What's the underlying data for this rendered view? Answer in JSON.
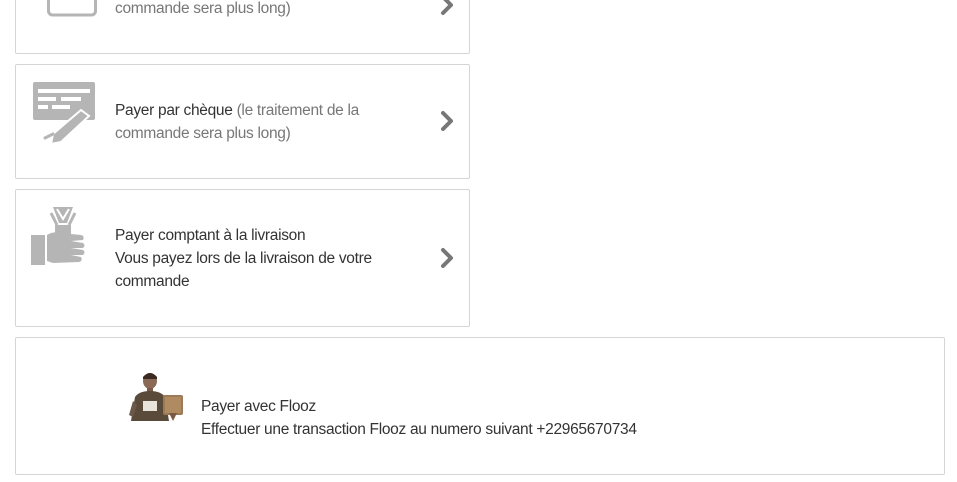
{
  "payment_options": [
    {
      "id": "bankwire",
      "label_line2": "commande sera plus long)",
      "icon": "bank-card-icon"
    },
    {
      "id": "cheque",
      "label_main": "Payer par chèque",
      "label_sub_start": " (le traitement de la",
      "label_sub_end": "commande sera plus long)",
      "icon": "cheque-pen-icon"
    },
    {
      "id": "cod",
      "label_main": "Payer comptant à la livraison",
      "label_line2": "Vous payez lors de la livraison de votre",
      "label_line3": "commande",
      "icon": "cash-in-hand-icon"
    },
    {
      "id": "flooz",
      "label_main": "Payer avec Flooz",
      "label_line2": "Effectuer une transaction Flooz au numero suivant +22965670734",
      "icon": "flooz-person-photo"
    }
  ],
  "colors": {
    "border": "#d6d4d4",
    "icon_gray": "#b5b5b5",
    "chevron": "#777777",
    "text_main": "#333333",
    "text_sub": "#777777"
  }
}
